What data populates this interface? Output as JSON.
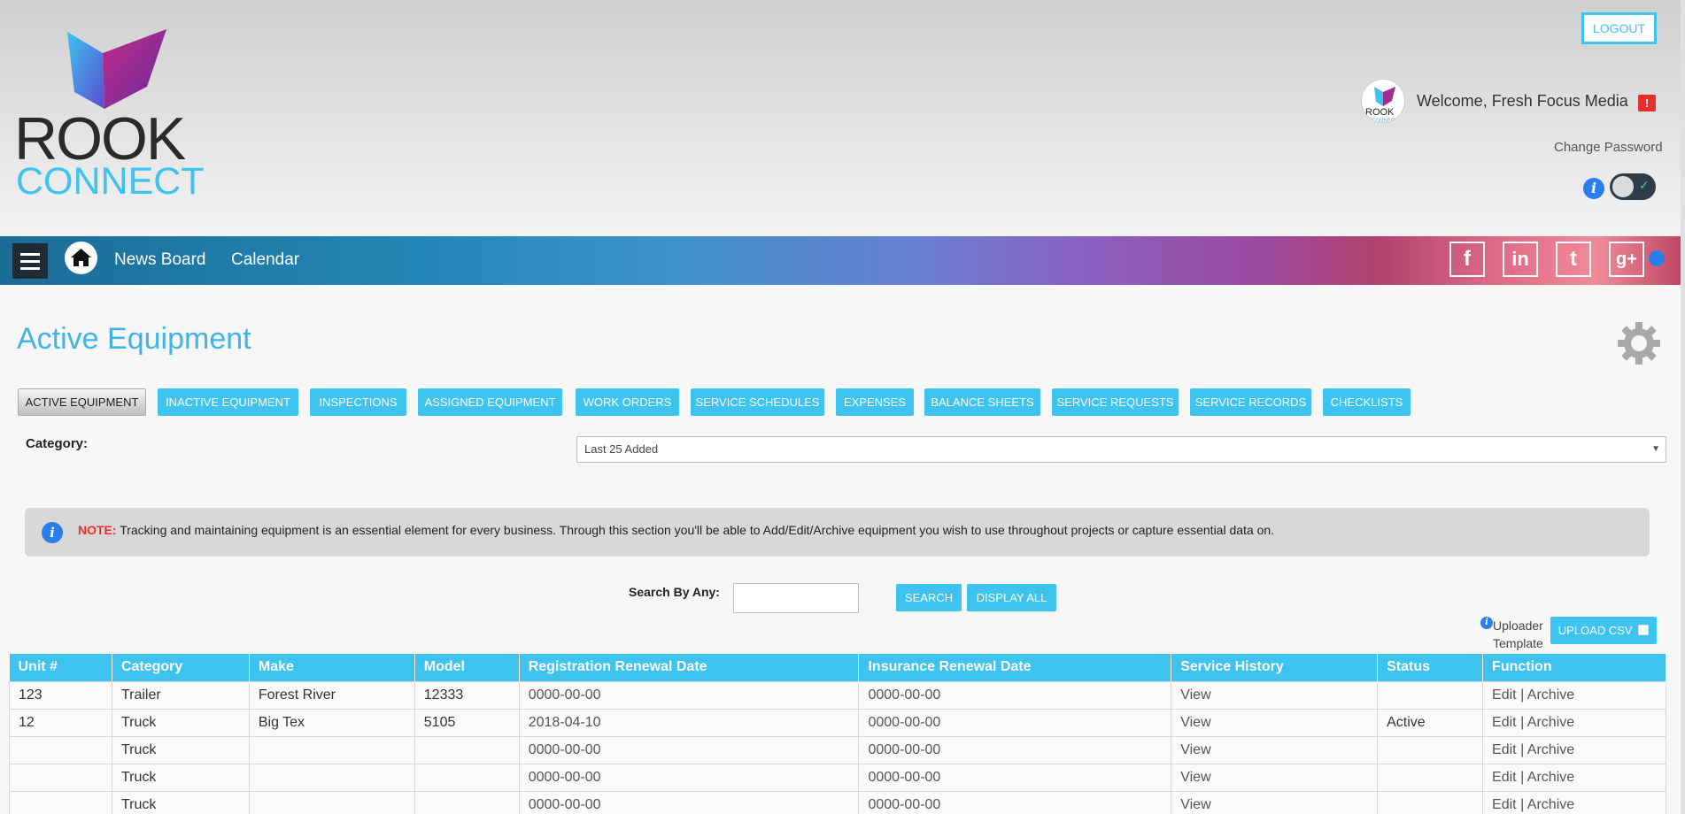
{
  "header": {
    "logo": {
      "line1": "ROOK",
      "line2": "CONNECT"
    },
    "logout_label": "LOGOUT",
    "welcome": "Welcome, Fresh Focus Media",
    "alert": "!",
    "change_password": "Change Password",
    "info_glyph": "i",
    "toggle_glyph": "✓"
  },
  "nav": {
    "links": [
      "News Board",
      "Calendar"
    ],
    "social": [
      {
        "name": "facebook-icon",
        "glyph": "f"
      },
      {
        "name": "linkedin-icon",
        "glyph": "in"
      },
      {
        "name": "twitter-icon",
        "glyph": "t"
      },
      {
        "name": "googleplus-icon",
        "glyph": "g+"
      }
    ]
  },
  "page": {
    "title": "Active Equipment",
    "tabs": [
      "ACTIVE EQUIPMENT",
      "INACTIVE EQUIPMENT",
      "INSPECTIONS",
      "ASSIGNED EQUIPMENT",
      "WORK ORDERS",
      "SERVICE SCHEDULES",
      "EXPENSES",
      "BALANCE SHEETS",
      "SERVICE REQUESTS",
      "SERVICE RECORDS",
      "CHECKLISTS"
    ],
    "category_label": "Category:",
    "category_value": "Last 25 Added",
    "note_label": "NOTE:",
    "note_text": " Tracking and maintaining equipment is an essential element for every business. Through this section you'll be able to Add/Edit/Archive equipment you wish to use throughout projects or capture essential data on.",
    "search_label": "Search By Any:",
    "search_value": "",
    "search_button": "SEARCH",
    "display_all_button": "DISPLAY ALL",
    "uploader_line1": "Uploader",
    "uploader_line2": "Template",
    "upload_csv_button": "UPLOAD CSV"
  },
  "table": {
    "columns": [
      "Unit #",
      "Category",
      "Make",
      "Model",
      "Registration Renewal Date",
      "Insurance Renewal Date",
      "Service History",
      "Status",
      "Function"
    ],
    "rows": [
      {
        "unit": "123",
        "category": "Trailer",
        "make": "Forest River",
        "model": "12333",
        "reg": "0000-00-00",
        "ins": "0000-00-00",
        "history": "View",
        "status": "",
        "edit": "Edit",
        "sep": "|",
        "archive": "Archive"
      },
      {
        "unit": "12",
        "category": "Truck",
        "make": "Big Tex",
        "model": "5105",
        "reg": "2018-04-10",
        "ins": "0000-00-00",
        "history": "View",
        "status": "Active",
        "edit": "Edit",
        "sep": "|",
        "archive": "Archive"
      },
      {
        "unit": "",
        "category": "Truck",
        "make": "",
        "model": "",
        "reg": "0000-00-00",
        "ins": "0000-00-00",
        "history": "View",
        "status": "",
        "edit": "Edit",
        "sep": "|",
        "archive": "Archive"
      },
      {
        "unit": "",
        "category": "Truck",
        "make": "",
        "model": "",
        "reg": "0000-00-00",
        "ins": "0000-00-00",
        "history": "View",
        "status": "",
        "edit": "Edit",
        "sep": "|",
        "archive": "Archive"
      },
      {
        "unit": "",
        "category": "Truck",
        "make": "",
        "model": "",
        "reg": "0000-00-00",
        "ins": "0000-00-00",
        "history": "View",
        "status": "",
        "edit": "Edit",
        "sep": "|",
        "archive": "Archive"
      }
    ]
  }
}
